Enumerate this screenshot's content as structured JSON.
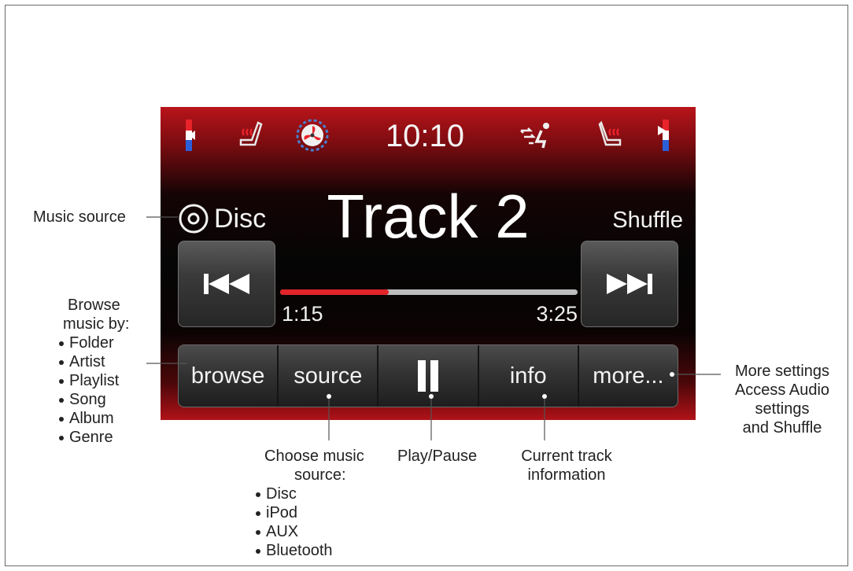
{
  "head_unit": {
    "status": {
      "clock": "10:10"
    },
    "now_playing": {
      "source": "Disc",
      "track": "Track 2",
      "shuffle_label": "Shuffle",
      "elapsed": "1:15",
      "duration": "3:25",
      "progress_fraction": 0.366
    },
    "tabs": [
      {
        "label": "browse"
      },
      {
        "label": "source"
      },
      {
        "label": "pause-icon"
      },
      {
        "label": "info"
      },
      {
        "label": "more..."
      }
    ],
    "colors": {
      "accent": "#e0242a",
      "bezel_red": "#b8141a"
    }
  },
  "callouts": {
    "music_source": "Music source",
    "browse": {
      "title_line1": "Browse",
      "title_line2": "music by:",
      "items": [
        "Folder",
        "Artist",
        "Playlist",
        "Song",
        "Album",
        "Genre"
      ]
    },
    "source": {
      "title_line1": "Choose music",
      "title_line2": "source:",
      "items": [
        "Disc",
        "iPod",
        "AUX",
        "Bluetooth"
      ]
    },
    "play_pause": "Play/Pause",
    "info": {
      "line1": "Current track",
      "line2": "information"
    },
    "more": {
      "line1": "More settings",
      "line2": "Access Audio",
      "line3": "settings",
      "line4": "and Shuffle"
    }
  }
}
